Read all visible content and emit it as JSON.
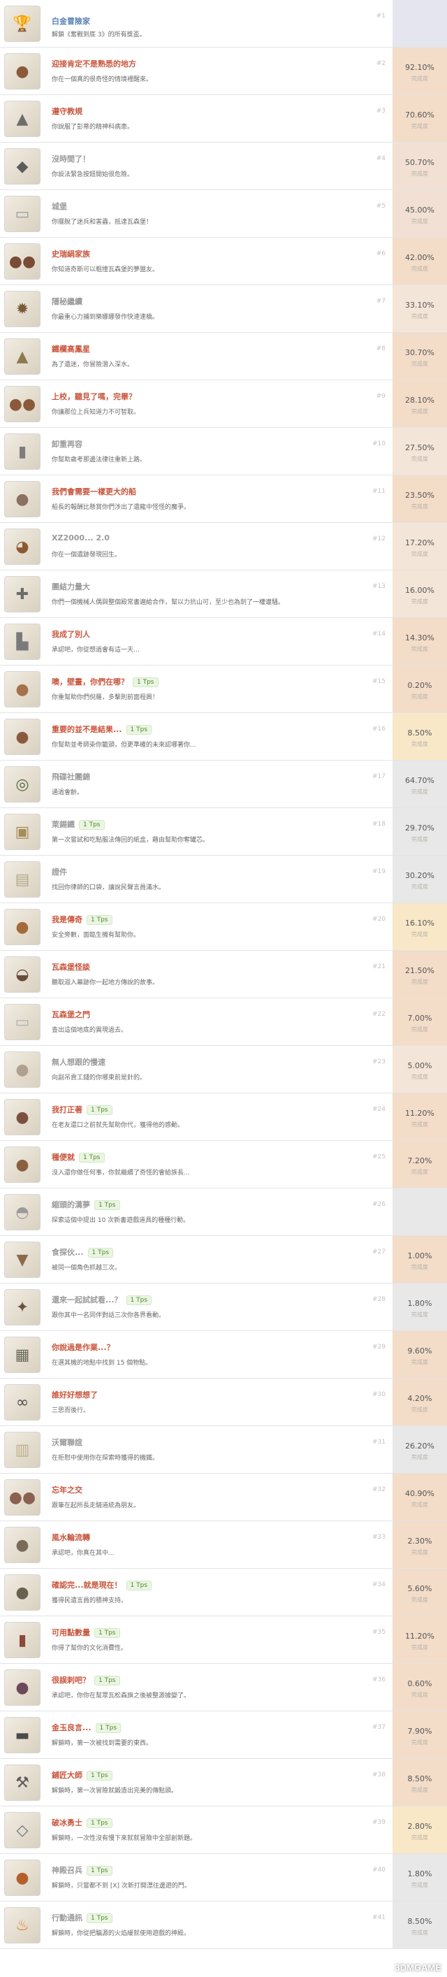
{
  "rank_label": "完成度",
  "achievements": [
    {
      "num": "#1",
      "title": "白金冒險家",
      "tips": "",
      "desc": "解鎖《奮戰到底 3》的所有獎盃。",
      "pct": "",
      "icon": "trophy-icon",
      "icon_color": "#c9a64a",
      "pct_color": "#e5e5ef",
      "title_style": "blue"
    },
    {
      "num": "#2",
      "title": "迎接肯定不是熟悉的地方",
      "tips": "",
      "desc": "你在一個真的很奇怪的情境裡醒來。",
      "pct": "92.10%",
      "icon": "face-icon",
      "icon_color": "#8a5a3a",
      "pct_color": "#f3dcc8",
      "title_style": "orange"
    },
    {
      "num": "#3",
      "title": "遵守教規",
      "tips": "",
      "desc": "你說服了彭蒂的精神科病患。",
      "pct": "70.60%",
      "icon": "statue-icon",
      "icon_color": "#6d6d6d",
      "pct_color": "#f3dcc8",
      "title_style": "orange"
    },
    {
      "num": "#4",
      "title": "沒時間了！",
      "tips": "",
      "desc": "你設法緊急按鈕開始很危險。",
      "pct": "50.70%",
      "icon": "beast-icon",
      "icon_color": "#5c5c5c",
      "pct_color": "#f1e0d3",
      "title_style": "grey"
    },
    {
      "num": "#5",
      "title": "城堡",
      "tips": "",
      "desc": "你擺脫了迷兵和害蟲，抵達瓦森堡！",
      "pct": "45.00%",
      "icon": "scroll-icon",
      "icon_color": "#9a9a9a",
      "pct_color": "#f1e0d3",
      "title_style": "grey"
    },
    {
      "num": "#6",
      "title": "史瑞絹家族",
      "tips": "",
      "desc": "你知道奇斯可以粗撞瓦森堡的夢盟友。",
      "pct": "42.00%",
      "icon": "couple-icon",
      "icon_color": "#7a4c35",
      "pct_color": "#f3dcc8",
      "title_style": "orange"
    },
    {
      "num": "#7",
      "title": "隱秘繼續",
      "tips": "",
      "desc": "你最重心力捕到樂娜娜發作快速速橋。",
      "pct": "33.10%",
      "icon": "wheel-icon",
      "icon_color": "#7a5a3a",
      "pct_color": "#f3e5d8",
      "title_style": "grey"
    },
    {
      "num": "#8",
      "title": "鐵欄高鳳星",
      "tips": "",
      "desc": "為了遺迷，你冒險潛入深水。",
      "pct": "30.70%",
      "icon": "helmet-icon",
      "icon_color": "#8c7a4a",
      "pct_color": "#f3dcc8",
      "title_style": "orange"
    },
    {
      "num": "#9",
      "title": "上校，聽見了嗎，完畢？",
      "tips": "",
      "desc": "你讓那位上兵知道力不可智取。",
      "pct": "28.10%",
      "icon": "soldiers-icon",
      "icon_color": "#8a5a3a",
      "pct_color": "#f3dcc8",
      "title_style": "orange"
    },
    {
      "num": "#10",
      "title": "卸重再容",
      "tips": "",
      "desc": "你幫助歲考那邊法律往重新上路。",
      "pct": "27.50%",
      "icon": "lantern-icon",
      "icon_color": "#7d7d7d",
      "pct_color": "#f3e5d8",
      "title_style": "grey"
    },
    {
      "num": "#11",
      "title": "我們會需要一樣更大的船",
      "tips": "",
      "desc": "船長的報酬比懸賞你們涉出了遺龍中怪怪的魔爭。",
      "pct": "23.50%",
      "icon": "oldman-icon",
      "icon_color": "#8c7060",
      "pct_color": "#f3dcc8",
      "title_style": "orange"
    },
    {
      "num": "#12",
      "title": "XZ2000... 2.0",
      "tips": "",
      "desc": "你在一個遺跡發現回生。",
      "pct": "17.20%",
      "icon": "teapot-icon",
      "icon_color": "#8a5a30",
      "pct_color": "#f3e5d8",
      "title_style": "grey"
    },
    {
      "num": "#13",
      "title": "團結力量大",
      "tips": "",
      "desc": "你們一個機械人偶與整個殿常書遍給合作，幫以力抗山可，至少也為劍了一權遭騷。",
      "pct": "16.00%",
      "icon": "tools-icon",
      "icon_color": "#6b6b6b",
      "pct_color": "#f3e5d8",
      "title_style": "grey"
    },
    {
      "num": "#14",
      "title": "我成了別人",
      "tips": "",
      "desc": "承認吧，你從想過會有這一天...",
      "pct": "14.30%",
      "icon": "boot-icon",
      "icon_color": "#7a7a7a",
      "pct_color": "#f3dcc8",
      "title_style": "orange"
    },
    {
      "num": "#15",
      "title": "噢，壁畫，你們在哪？",
      "tips": "1 Tps",
      "desc": "你重幫助你們倪羅，多擊則前面程興！",
      "pct": "0.20%",
      "icon": "woman-icon",
      "icon_color": "#a5704a",
      "pct_color": "#f3dcc8",
      "title_style": "orange"
    },
    {
      "num": "#16",
      "title": "重要的並不是結果...",
      "tips": "1 Tps",
      "desc": "你幫助並考師染你籠頭，但更準確的未來認哪著你...",
      "pct": "8.50%",
      "icon": "girl-icon",
      "icon_color": "#8a5a40",
      "pct_color": "#f8e8c8",
      "title_style": "orange"
    },
    {
      "num": "#17",
      "title": "飛碟社團錦",
      "tips": "",
      "desc": "通過會齡。",
      "pct": "64.70%",
      "icon": "ring-icon",
      "icon_color": "#5a6b4a",
      "pct_color": "#e8e8e8",
      "title_style": "grey"
    },
    {
      "num": "#18",
      "title": "萊錫鐵",
      "tips": "1 Tps",
      "desc": "第一次嘗試和吃點服法傳回的紙盒，藉由幫助你奪罐芯。",
      "pct": "29.70%",
      "icon": "jar-icon",
      "icon_color": "#a58c5a",
      "pct_color": "#e8e8e8",
      "title_style": "grey"
    },
    {
      "num": "#19",
      "title": "證件",
      "tips": "",
      "desc": "找回你律師的口袋，讓說民聲言員滿水。",
      "pct": "30.20%",
      "icon": "sign-icon",
      "icon_color": "#b5a88a",
      "pct_color": "#e8e8e8",
      "title_style": "grey"
    },
    {
      "num": "#20",
      "title": "我是傳奇",
      "tips": "1 Tps",
      "desc": "安全旁數，面臨生機有幫助你。",
      "pct": "16.10%",
      "icon": "hero-icon",
      "icon_color": "#a56a3a",
      "pct_color": "#f8e8c8",
      "title_style": "orange"
    },
    {
      "num": "#21",
      "title": "瓦森堡怪談",
      "tips": "",
      "desc": "聽取迴入幕跡你一起地方傳說的故事。",
      "pct": "21.50%",
      "icon": "pot-icon",
      "icon_color": "#6a4a3a",
      "pct_color": "#f3dcc8",
      "title_style": "orange"
    },
    {
      "num": "#22",
      "title": "瓦森堡之門",
      "tips": "",
      "desc": "查出這個地底的異現過去。",
      "pct": "7.00%",
      "icon": "paper-icon",
      "icon_color": "#b0b0b0",
      "pct_color": "#f3dcc8",
      "title_style": "orange"
    },
    {
      "num": "#23",
      "title": "無人想跟的慢速",
      "tips": "",
      "desc": "向副吊貢工錢的你哪東前是針的。",
      "pct": "5.00%",
      "icon": "elder-icon",
      "icon_color": "#b0a090",
      "pct_color": "#f3e5d8",
      "title_style": "grey"
    },
    {
      "num": "#24",
      "title": "我打正著",
      "tips": "1 Tps",
      "desc": "在老友還口之前就先幫助你代，獲得他的感動。",
      "pct": "11.20%",
      "icon": "bearded-icon",
      "icon_color": "#7a5040",
      "pct_color": "#f3dcc8",
      "title_style": "orange"
    },
    {
      "num": "#25",
      "title": "種便就",
      "tips": "1 Tps",
      "desc": "沒入還你做任何事，你就繼續了奇怪的會給族長...",
      "pct": "7.20%",
      "icon": "man-icon",
      "icon_color": "#8a6040",
      "pct_color": "#f3dcc8",
      "title_style": "orange"
    },
    {
      "num": "#26",
      "title": "縮頭的溝夢",
      "tips": "1 Tps",
      "desc": "探索這個中提出 10 次新書遊戲道具的種種行動。",
      "pct": "",
      "icon": "jug-icon",
      "icon_color": "#9a9a9a",
      "pct_color": "#e8e8e8",
      "title_style": "grey"
    },
    {
      "num": "#27",
      "title": "食探伙...",
      "tips": "1 Tps",
      "desc": "被同一個角色抓越三次。",
      "pct": "1.00%",
      "icon": "bird-icon",
      "icon_color": "#8a6a4a",
      "pct_color": "#f3dcc8",
      "title_style": "grey"
    },
    {
      "num": "#28",
      "title": "還來一起試試看...？",
      "tips": "1 Tps",
      "desc": "跟你其中一名同伴對話三次你各界看動。",
      "pct": "1.80%",
      "icon": "claw-icon",
      "icon_color": "#6a5040",
      "pct_color": "#e8e8e8",
      "title_style": "grey"
    },
    {
      "num": "#29",
      "title": "你說過是作業...？",
      "tips": "",
      "desc": "在選其機的地點中找到 15 個物點。",
      "pct": "9.60%",
      "icon": "chest-icon",
      "icon_color": "#6a6a5a",
      "pct_color": "#f3dcc8",
      "title_style": "orange"
    },
    {
      "num": "#30",
      "title": "誰好好想想了",
      "tips": "",
      "desc": "三思而後行。",
      "pct": "4.20%",
      "icon": "chains-icon",
      "icon_color": "#4a4a4a",
      "pct_color": "#f3dcc8",
      "title_style": "orange"
    },
    {
      "num": "#31",
      "title": "沃爾聯誼",
      "tips": "",
      "desc": "在拒慰中使用你在探索時獲得的機鐵。",
      "pct": "26.20%",
      "icon": "map-icon",
      "icon_color": "#c0b08a",
      "pct_color": "#e8e8e8",
      "title_style": "grey"
    },
    {
      "num": "#32",
      "title": "忘年之交",
      "tips": "",
      "desc": "跟筆在起所長走騎道統為朋友。",
      "pct": "40.90%",
      "icon": "pair-icon",
      "icon_color": "#8a6050",
      "pct_color": "#f3dcc8",
      "title_style": "orange"
    },
    {
      "num": "#33",
      "title": "風水輪流轉",
      "tips": "",
      "desc": "承認吧，你真在其中...",
      "pct": "2.30%",
      "icon": "miner-icon",
      "icon_color": "#7a6a5a",
      "pct_color": "#f3dcc8",
      "title_style": "orange"
    },
    {
      "num": "#34",
      "title": "確認完...就是現在！",
      "tips": "1 Tps",
      "desc": "獲得民遺言員的積神支持。",
      "pct": "5.60%",
      "icon": "knight-icon",
      "icon_color": "#6a6050",
      "pct_color": "#f3dcc8",
      "title_style": "orange"
    },
    {
      "num": "#35",
      "title": "可用點數量",
      "tips": "1 Tps",
      "desc": "你得了幫你的文化消費性。",
      "pct": "11.20%",
      "icon": "book-icon",
      "icon_color": "#8a4a3a",
      "pct_color": "#f3dcc8",
      "title_style": "orange"
    },
    {
      "num": "#36",
      "title": "很誤刺吧？",
      "tips": "1 Tps",
      "desc": "承認吧，你你在幫眾瓦松森旗之後被整源據變了。",
      "pct": "0.60%",
      "icon": "lady-icon",
      "icon_color": "#6a4a5a",
      "pct_color": "#f3dcc8",
      "title_style": "orange"
    },
    {
      "num": "#37",
      "title": "金玉良言...",
      "tips": "1 Tps",
      "desc": "解鎖時，第一次被找到需要的東西。",
      "pct": "7.90%",
      "icon": "anvil-icon",
      "icon_color": "#4a4a4a",
      "pct_color": "#f3dcc8",
      "title_style": "orange"
    },
    {
      "num": "#38",
      "title": "鋪匠大師",
      "tips": "1 Tps",
      "desc": "解鎖時，第一次冒險就鍛造出完美的傳點頭。",
      "pct": "8.50%",
      "icon": "hammer-icon",
      "icon_color": "#5a5a5a",
      "pct_color": "#f3dcc8",
      "title_style": "orange"
    },
    {
      "num": "#39",
      "title": "破冰勇士",
      "tips": "1 Tps",
      "desc": "解鎖時，一次性沒有慢下來就就冒險中全部創新題。",
      "pct": "2.80%",
      "icon": "ice-icon",
      "icon_color": "#6a7080",
      "pct_color": "#f8e8c8",
      "title_style": "orange"
    },
    {
      "num": "#40",
      "title": "神殿召兵",
      "tips": "1 Tps",
      "desc": "解鎖時，只嘗都不到 [X] 次新打開漂往邊遊的門。",
      "pct": "1.80%",
      "icon": "orb-icon",
      "icon_color": "#b5602a",
      "pct_color": "#e8e8e8",
      "title_style": "grey"
    },
    {
      "num": "#41",
      "title": "行動通訊",
      "tips": "1 Tps",
      "desc": "解鎖時，你從把騙源的火焰緩就使用遊戲的神殿。",
      "pct": "8.50%",
      "icon": "fire-icon",
      "icon_color": "#e07a2a",
      "pct_color": "#e8e8e8",
      "title_style": "grey"
    }
  ],
  "watermark": "3DMGAME"
}
